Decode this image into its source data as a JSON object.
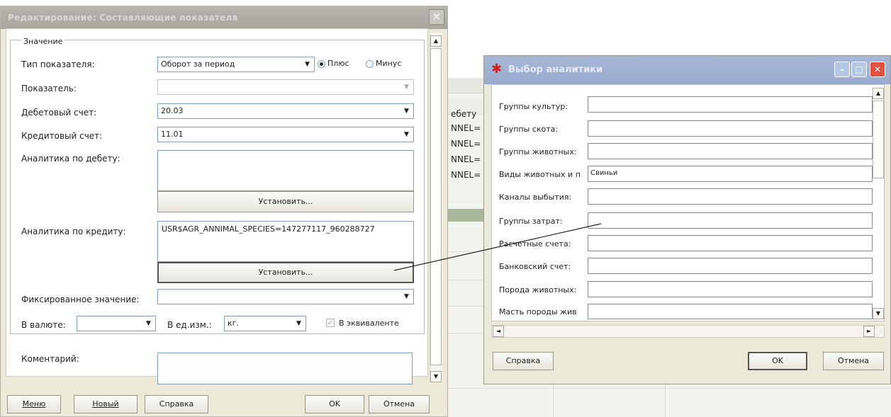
{
  "background": {
    "visible_text": [
      "ебету",
      "NNEL=",
      "NNEL=",
      "NNEL=",
      "NNEL="
    ]
  },
  "dialog1": {
    "title": "Редактирование: Составляющие показателя",
    "close_icon": "close-icon",
    "group_label": "Значение",
    "indicator_type": {
      "label": "Тип показателя:",
      "value": "Оборот за период"
    },
    "sign_options": {
      "plus": "Плюс",
      "minus": "Минус",
      "selected": "plus"
    },
    "indicator": {
      "label": "Показатель:",
      "value": ""
    },
    "debit_account": {
      "label": "Дебетовый счет:",
      "value": "20.03"
    },
    "credit_account": {
      "label": "Кредитовый счет:",
      "value": "11.01"
    },
    "debit_analytics": {
      "label": "Аналитика по дебету:",
      "value": "",
      "button": "Установить..."
    },
    "credit_analytics": {
      "label": "Аналитика по кредиту:",
      "value": "USR$AGR_ANNIMAL_SPECIES=147277117_960288727",
      "button": "Установить..."
    },
    "fixed_value": {
      "label": "Фиксированное значение:",
      "value": ""
    },
    "currency": {
      "label": "В валюте:",
      "value": ""
    },
    "unit": {
      "label": "В ед.изм.:",
      "value": "кг."
    },
    "equivalent": {
      "label": "В эквиваленте",
      "checked": true,
      "disabled": true
    },
    "comment": {
      "label": "Коментарий:",
      "value": ""
    },
    "buttons": {
      "menu": "Меню",
      "new": "Новый",
      "help": "Справка",
      "ok": "OK",
      "cancel": "Отмена"
    }
  },
  "dialog2": {
    "title": "Выбор аналитики",
    "logo_icon": "app-logo-icon",
    "rows": [
      {
        "label": "Группы культур:",
        "value": ""
      },
      {
        "label": "Группы скота:",
        "value": ""
      },
      {
        "label": "Группы животных:",
        "value": ""
      },
      {
        "label": "Виды животных и п",
        "value": "Свиньи"
      },
      {
        "label": "Каналы выбытия:",
        "value": ""
      },
      {
        "label": "Группы затрат:",
        "value": ""
      },
      {
        "label": "Расчетные счета:",
        "value": ""
      },
      {
        "label": "Банковский счет:",
        "value": ""
      },
      {
        "label": "Порода животных:",
        "value": ""
      },
      {
        "label": "Масть породы жив",
        "value": ""
      }
    ],
    "buttons": {
      "help": "Справка",
      "ok": "OK",
      "cancel": "Отмена"
    },
    "title_buttons": [
      "minimize-icon",
      "maximize-icon",
      "close-icon"
    ]
  },
  "colors": {
    "dialog_face": "#ece9d8",
    "dialog1_title": "#b7b4ad",
    "dialog2_title": "#a7b8d8",
    "close_red": "#e0503c",
    "field_border": "#7f9db9"
  }
}
